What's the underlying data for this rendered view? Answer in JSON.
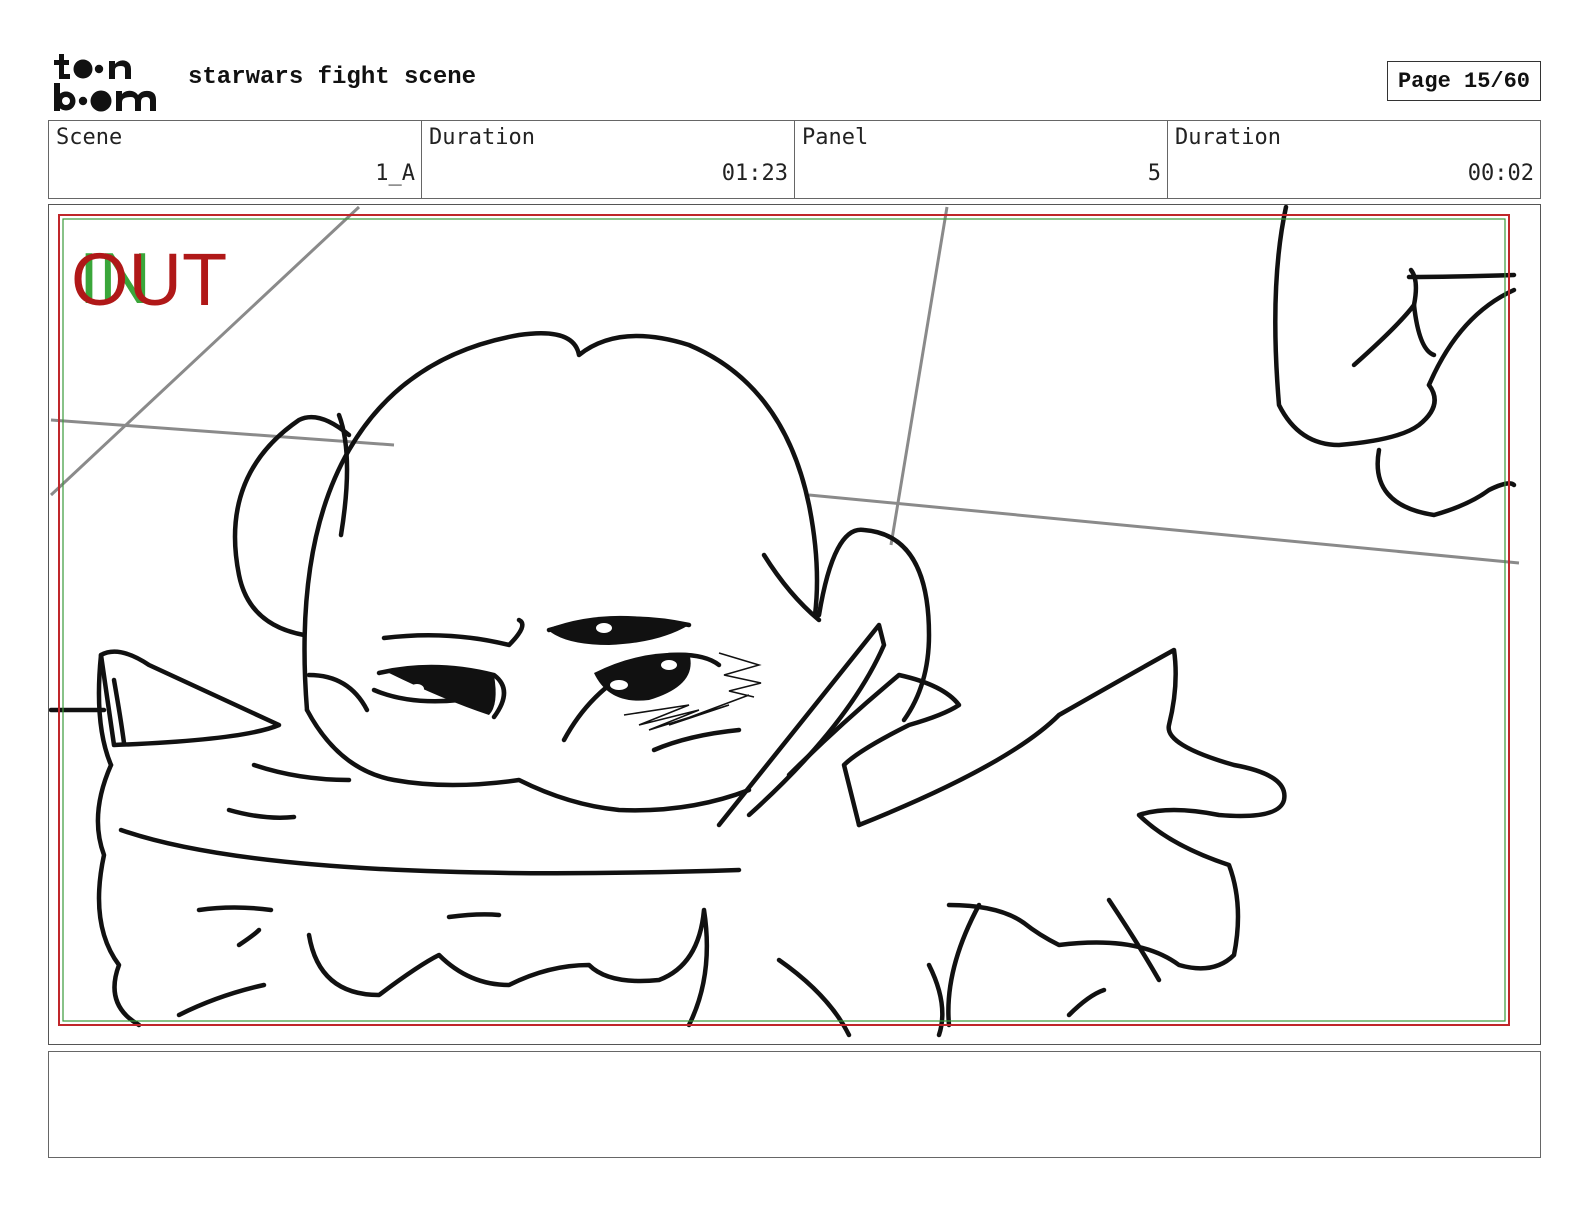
{
  "header": {
    "logo_text": "toon boom",
    "title": "starwars fight scene",
    "page_label": "Page 15/60"
  },
  "info": {
    "scene_label": "Scene",
    "scene_value": "1_A",
    "scene_duration_label": "Duration",
    "scene_duration_value": "01:23",
    "panel_label": "Panel",
    "panel_value": "5",
    "panel_duration_label": "Duration",
    "panel_duration_value": "00:02"
  },
  "panel": {
    "in_marker": "IN",
    "out_marker": "OUT",
    "in_color": "#3aa63a",
    "out_color": "#b01818",
    "safe_frame_color": "#c0262a",
    "title_safe_color": "#3a9a3a"
  },
  "notes": {
    "text": ""
  }
}
